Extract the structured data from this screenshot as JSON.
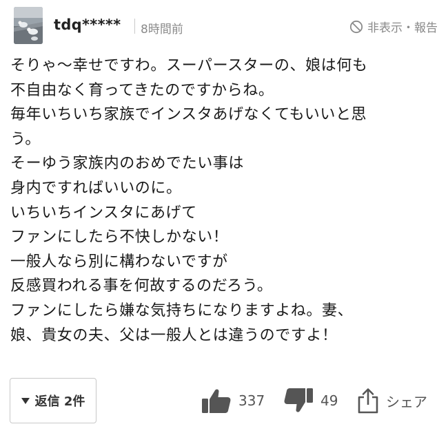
{
  "comment": {
    "user": {
      "name": "tdq*****",
      "avatar_icon": "avatar-photo-seagulls"
    },
    "timestamp": "8時間前",
    "hide_report_label": "非表示・報告",
    "body_lines": [
      "そりゃ〜幸せですわ。スーパースターの、娘は何も",
      "不自由なく育ってきたのですからね。",
      "毎年いちいち家族でインスタあげなくてもいいと思",
      "う。",
      "そーゆう家族内のおめでたい事は",
      "身内ですればいいのに。",
      "いちいちインスタにあげて",
      "ファンにしたら不快しかない！",
      "一般人なら別に構わないですが",
      "反感買われる事を何故するのだろう。",
      "ファンにしたら嫌な気持ちになりますよね。妻、",
      "娘、貴女の夫、父は一般人とは違うのですよ！"
    ]
  },
  "footer": {
    "reply_label": "返信 2件",
    "likes": "337",
    "dislikes": "49",
    "share_label": "シェア"
  },
  "colors": {
    "text": "#1a1a1a",
    "muted": "#8a8a8a",
    "icon": "#555555",
    "border": "#c8c8c8"
  }
}
